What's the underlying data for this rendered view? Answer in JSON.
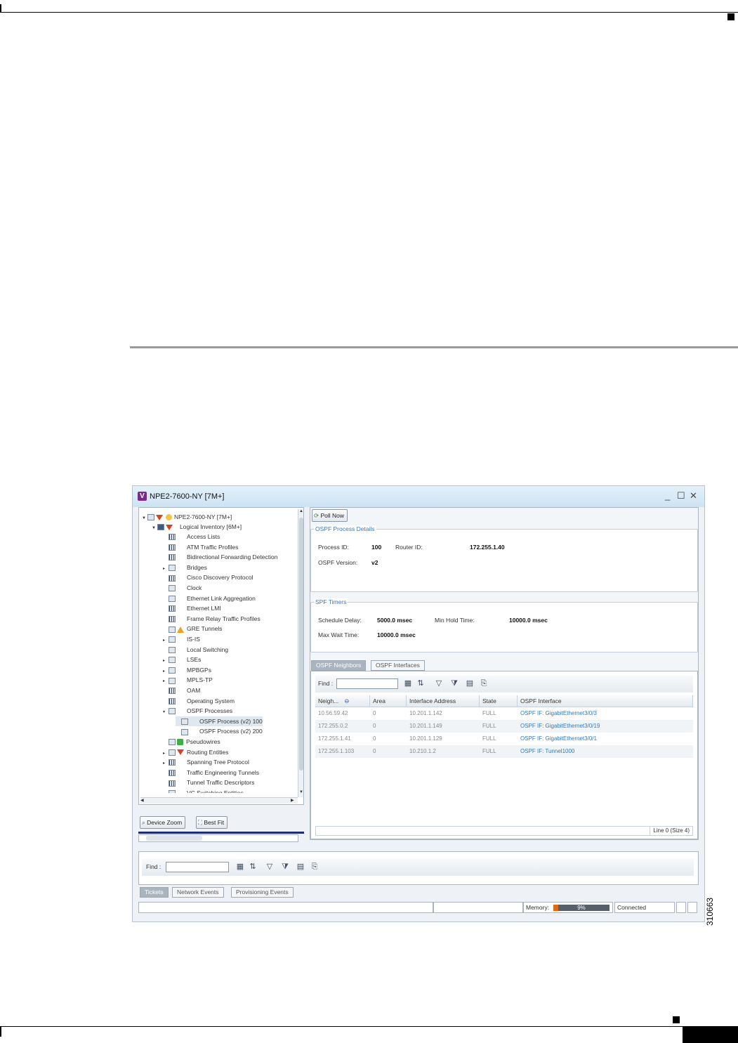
{
  "figure": {
    "id": "310663"
  },
  "window": {
    "title": "NPE2-7600-NY [7M+]",
    "logo": "V",
    "controls": {
      "minimize": "_",
      "maximize": "☐",
      "close": "✕"
    }
  },
  "tree": {
    "root": "NPE2-7600-NY [7M+]",
    "logical": "Logical Inventory [6M+]",
    "items": [
      "Access Lists",
      "ATM Traffic Profiles",
      "Bidirectional Forwarding Detection",
      "Bridges",
      "Cisco Discovery Protocol",
      "Clock",
      "Ethernet Link Aggregation",
      "Ethernet LMI",
      "Frame Relay Traffic Profiles",
      "GRE Tunnels",
      "IS-IS",
      "Local Switching",
      "LSEs",
      "MPBGPs",
      "MPLS-TP",
      "OAM",
      "Operating System",
      "OSPF Processes",
      "OSPF Process (v2) 100",
      "OSPF Process (v2) 200",
      "Pseudowires",
      "Routing Entities",
      "Spanning Tree Protocol",
      "Traffic Engineering Tunnels",
      "Tunnel Traffic Descriptors",
      "VC Switching Entities"
    ]
  },
  "zoom": {
    "device_zoom": "Device Zoom",
    "best_fit": "Best Fit"
  },
  "toolbar": {
    "poll_now": "Poll Now"
  },
  "process_details": {
    "legend": "OSPF Process Details",
    "process_id_label": "Process ID:",
    "process_id": "100",
    "router_id_label": "Router ID:",
    "router_id": "172.255.1.40",
    "version_label": "OSPF Version:",
    "version": "v2"
  },
  "spf_timers": {
    "legend": "SPF Timers",
    "schedule_delay_label": "Schedule Delay:",
    "schedule_delay": "5000.0 msec",
    "min_hold_label": "Min Hold Time:",
    "min_hold": "10000.0 msec",
    "max_wait_label": "Max Wait Time:",
    "max_wait": "10000.0 msec"
  },
  "tabs": {
    "neighbors": "OSPF Neighbors",
    "interfaces": "OSPF Interfaces"
  },
  "find": {
    "label": "Find :"
  },
  "table": {
    "columns": [
      "Neigh...",
      "Area",
      "Interface Address",
      "State",
      "OSPF Interface"
    ],
    "rows": [
      [
        "10.56.59.42",
        "0",
        "10.201.1.142",
        "FULL",
        "OSPF IF: GigabitEthernet3/0/3"
      ],
      [
        "172.255.0.2",
        "0",
        "10.201.1.149",
        "FULL",
        "OSPF IF: GigabitEthernet3/0/19"
      ],
      [
        "172.255.1.41",
        "0",
        "10.201.1.129",
        "FULL",
        "OSPF IF: GigabitEthernet3/0/1"
      ],
      [
        "172.255.1.103",
        "0",
        "10.210.1.2",
        "FULL",
        "OSPF IF: Tunnel1000"
      ]
    ],
    "footer": "Line 0 (Size 4)"
  },
  "bottom": {
    "find_label": "Find :",
    "tabs": [
      "Tickets",
      "Network Events",
      "Provisioning Events"
    ]
  },
  "status": {
    "memory_label": "Memory:",
    "memory_value": "9%",
    "memory_fraction": 0.09,
    "connection": "Connected"
  }
}
